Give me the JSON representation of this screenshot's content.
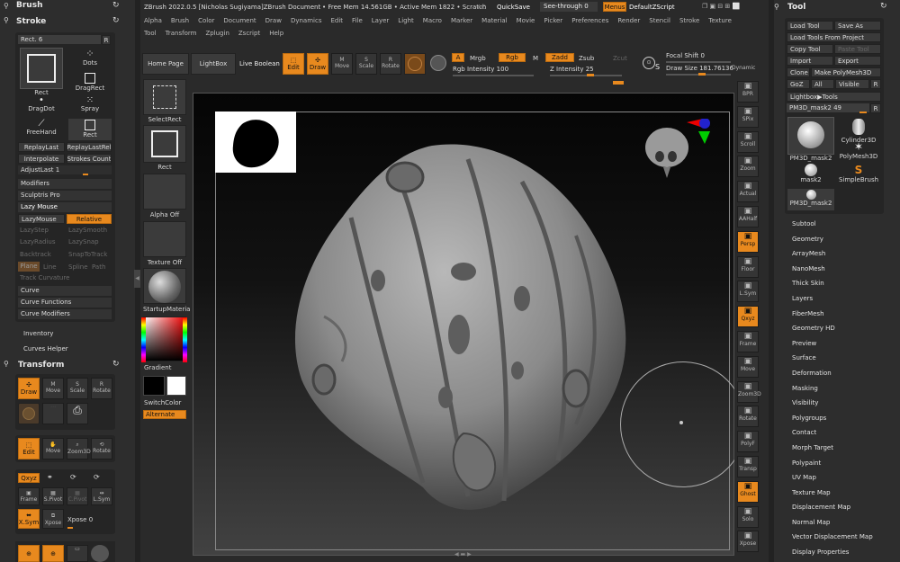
{
  "title_bar": {
    "app": "ZBrush 2022.0.5 [Nicholas Sugiyama]ZBrush Document",
    "free_mem": "• Free Mem 14.561GB • Active Mem 1822 • Scratch",
    "ac": "AC",
    "quicksave": "QuickSave",
    "see_through": "See-through  0",
    "menus": "Menus",
    "script": "DefaultZScript"
  },
  "menu_row1": [
    "Alpha",
    "Brush",
    "Color",
    "Document",
    "Draw",
    "Dynamics",
    "Edit",
    "File",
    "Layer",
    "Light",
    "Macro",
    "Marker",
    "Material",
    "Movie",
    "Picker",
    "Preferences",
    "Render",
    "Stencil",
    "Stroke",
    "Texture"
  ],
  "menu_row2": [
    "Tool",
    "Transform",
    "Zplugin",
    "Zscript",
    "Help"
  ],
  "toolbar": {
    "home_page": "Home Page",
    "lightbox": "LightBox",
    "live_boolean": "Live Boolean",
    "edit": "Edit",
    "draw": "Draw",
    "move": "Move",
    "scale": "Scale",
    "rotate": "Rotate",
    "a": "A",
    "mrgb": "Mrgb",
    "rgb": "Rgb",
    "m": "M",
    "zadd": "Zadd",
    "zsub": "Zsub",
    "zcut": "Zcut",
    "rgb_intensity": "Rgb Intensity 100",
    "z_intensity": "Z Intensity 25",
    "focal_shift": "Focal Shift 0",
    "draw_size": "Draw Size 181.76136",
    "dynamic": "Dynamic"
  },
  "left_panel": {
    "brush_title": "Brush",
    "stroke_title": "Stroke",
    "rect_slider": "Rect. 6",
    "r": "R",
    "stroke_types": [
      "Rect",
      "Dots",
      "DragRect",
      "DragDot",
      "Spray",
      "FreeHand",
      "Rect"
    ],
    "replay_last": "ReplayLast",
    "replay_last_rel": "ReplayLastRel",
    "interpolate": "Interpolate",
    "strokes_count": "Strokes Count",
    "adjust_last": "AdjustLast 1",
    "modifiers": "Modifiers",
    "sculptris_pro": "Sculptris Pro",
    "lazy_mouse": "Lazy Mouse",
    "lazy_mouse_btn": "LazyMouse",
    "relative": "Relative",
    "lazy_step": "LazyStep",
    "lazy_smooth": "LazySmooth",
    "lazy_radius": "LazyRadius",
    "lazy_snap": "LazySnap",
    "backtrack": "Backtrack",
    "snap_to_track": "SnapToTrack",
    "plane": "Plane",
    "line": "Line",
    "spline": "Spline",
    "path": "Path",
    "track_curvature": "Track Curvature",
    "curve": "Curve",
    "curve_functions": "Curve Functions",
    "curve_modifiers": "Curve Modifiers",
    "inventory": "Inventory",
    "curves_helper": "Curves Helper",
    "transform_title": "Transform",
    "t_draw": "Draw",
    "t_move": "Move",
    "t_scale": "Scale",
    "t_rotate": "Rotate",
    "t_edit": "Edit",
    "t_move2": "Move",
    "t_zoom3d": "Zoom3D",
    "t_rotate2": "Rotate",
    "xyz": "Qxyz",
    "frame": "Frame",
    "spivot": "S.Pivot",
    "cpivot": "C.Pivot",
    "lsym": "L.Sym",
    "xsym": "X.Sym",
    "xpose": "Xpose",
    "xpose_val": "Xpose 0"
  },
  "shelf": {
    "select_rect": "SelectRect",
    "rect": "Rect",
    "alpha_off": "Alpha Off",
    "texture_off": "Texture Off",
    "startup_material": "StartupMateria",
    "gradient": "Gradient",
    "switch_color": "SwitchColor",
    "alternate": "Alternate"
  },
  "right_tools": [
    {
      "label": "BPR"
    },
    {
      "label": "SPix"
    },
    {
      "label": "Scroll"
    },
    {
      "label": "Zoom"
    },
    {
      "label": "Actual"
    },
    {
      "label": "AAHalf"
    },
    {
      "label": "Persp"
    },
    {
      "label": "Floor"
    },
    {
      "label": "L.Sym"
    },
    {
      "label": "Qxyz"
    },
    {
      "label": "Frame"
    },
    {
      "label": "Move"
    },
    {
      "label": "Zoom3D"
    },
    {
      "label": "Rotate"
    },
    {
      "label": "PolyF"
    },
    {
      "label": "Transp"
    },
    {
      "label": "Ghost"
    },
    {
      "label": "Solo"
    },
    {
      "label": "Xpose"
    }
  ],
  "tool_panel": {
    "title": "Tool",
    "load_tool": "Load Tool",
    "save_as": "Save As",
    "load_from_project": "Load Tools From Project",
    "copy_tool": "Copy Tool",
    "paste_tool": "Paste Tool",
    "import": "Import",
    "export": "Export",
    "clone": "Clone",
    "make_polymesh": "Make PolyMesh3D",
    "goz": "GoZ",
    "all": "All",
    "visible": "Visible",
    "r": "R",
    "lightbox_tools": "Lightbox▶Tools",
    "current_tool": "PM3D_mask2  49",
    "thumbs": [
      "PM3D_mask2",
      "Cylinder3D",
      "PolyMesh3D",
      "mask2",
      "SimpleBrush",
      "PM3D_mask2"
    ],
    "sections": [
      "Subtool",
      "Geometry",
      "ArrayMesh",
      "NanoMesh",
      "Thick Skin",
      "Layers",
      "FiberMesh",
      "Geometry HD",
      "Preview",
      "Surface",
      "Deformation",
      "Masking",
      "Visibility",
      "Polygroups",
      "Contact",
      "Morph Target",
      "Polypaint",
      "UV Map",
      "Texture Map",
      "Displacement Map",
      "Normal Map",
      "Vector Displacement Map",
      "Display Properties"
    ]
  },
  "colors": {
    "accent": "#e8891e",
    "panel": "#2b2b2b",
    "canvas_top": "#0b0b0b",
    "canvas_bottom": "#3e3e3e"
  }
}
